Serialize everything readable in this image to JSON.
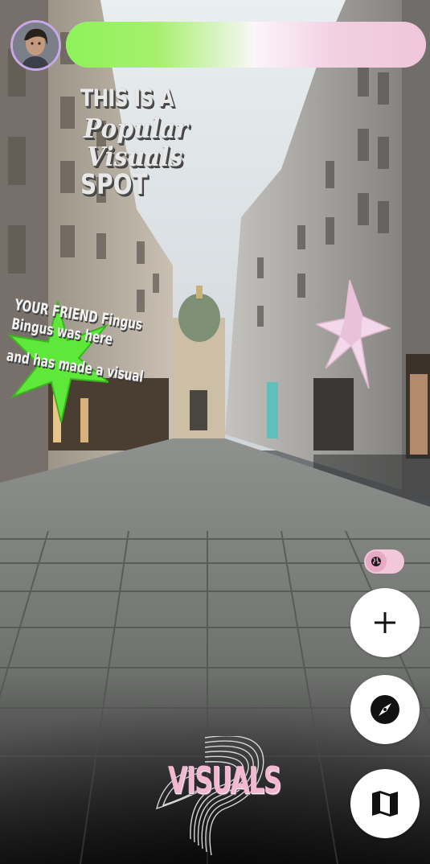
{
  "header": {
    "avatar": {
      "icon": "user-avatar"
    },
    "progress": {
      "fraction": 1.0,
      "colors": [
        "#8df25a",
        "#f0c4d8"
      ]
    }
  },
  "ar_stickers": {
    "spot": {
      "line1": "THIS IS A",
      "line2": "Popular",
      "line3": "Visuals",
      "line4": "SPOT"
    },
    "friend_note": {
      "line1": "YOUR FRIEND Fingus Bingus was here",
      "line2": "and has made a visual"
    },
    "starburst_colors": [
      "#5ee83a",
      "#f3d7ea"
    ]
  },
  "controls": {
    "toggle": {
      "icon": "globe-icon",
      "state": "off"
    },
    "add": {
      "icon": "plus-icon"
    },
    "explore": {
      "icon": "compass-icon"
    },
    "map": {
      "icon": "map-icon"
    }
  },
  "brand": {
    "logo_text": "VISUALS",
    "accent": "#f3b8cf"
  }
}
